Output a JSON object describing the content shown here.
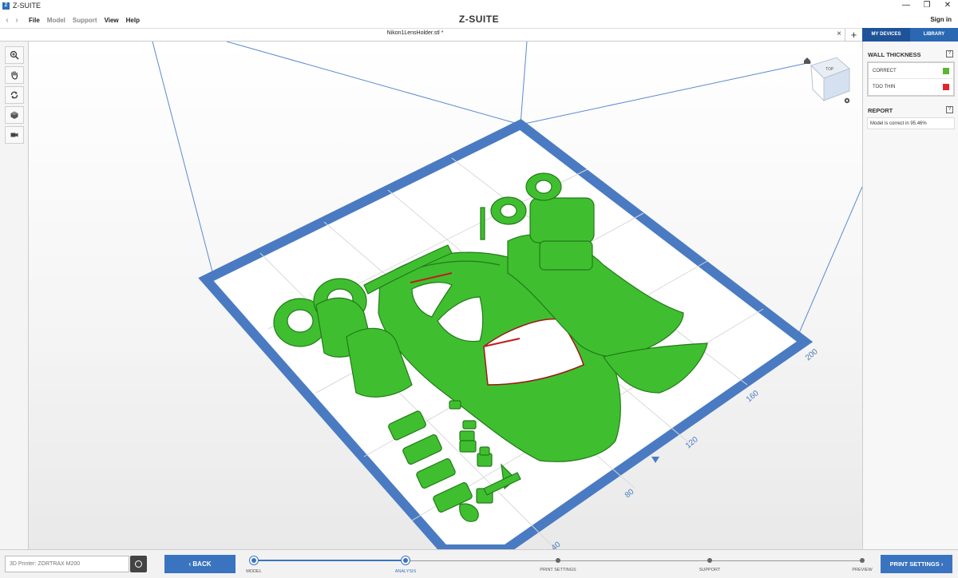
{
  "window": {
    "title": "Z-SUITE",
    "logo_letter": "Z",
    "controls": [
      "—",
      "❐",
      "✕"
    ]
  },
  "menu": {
    "back_arrow": "‹",
    "forward_arrow": "›",
    "items": [
      "File",
      "Model",
      "Support",
      "View",
      "Help"
    ],
    "brand": "Z-SUITE",
    "signin": "Sign in"
  },
  "tab": {
    "file_name": "Nikon1LensHolder.stl *",
    "close": "×",
    "add": "+"
  },
  "right_tabs": [
    "MY DEVICES",
    "LIBRARY"
  ],
  "toolbar": {
    "tools": [
      "zoom-icon",
      "pan-hand-icon",
      "rotate-icon",
      "view-cube-icon",
      "camera-icon"
    ]
  },
  "viewport": {
    "ruler_labels": [
      "200",
      "160",
      "120",
      "80",
      "40"
    ],
    "nav_cube_label": "TOP",
    "plate_color": "#4a7bc2",
    "model_color": "#3fbf2f",
    "model_outline": "#237a1a"
  },
  "panel": {
    "wall_thickness": {
      "title": "WALL THICKNESS",
      "help": "?",
      "rows": [
        {
          "label": "CORRECT",
          "color": "#5cb531"
        },
        {
          "label": "TOO THIN",
          "color": "#e0262a"
        }
      ]
    },
    "report": {
      "title": "REPORT",
      "help": "?",
      "text": "Model is correct in 95.46%"
    }
  },
  "bottom": {
    "printer_placeholder": "3D Printer: ZORTRAX M200",
    "back_label": "‹  BACK",
    "next_label": "PRINT SETTINGS  ›",
    "steps": [
      {
        "label": "MODEL",
        "done": true
      },
      {
        "label": "ANALYSIS",
        "done": true
      },
      {
        "label": "PRINT SETTINGS",
        "done": false
      },
      {
        "label": "SUPPORT",
        "done": false
      },
      {
        "label": "PREVIEW",
        "done": false
      }
    ]
  }
}
